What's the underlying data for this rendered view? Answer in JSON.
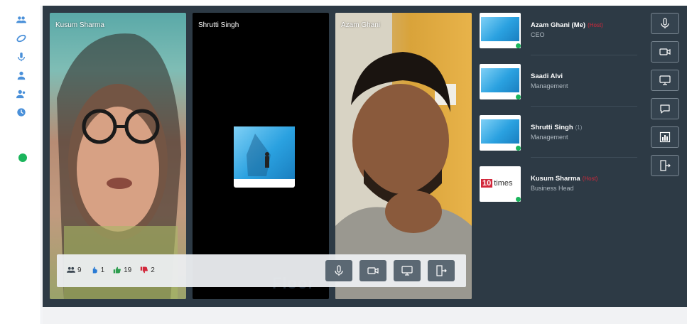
{
  "participants_tiles": [
    {
      "name": "Kusum Sharma"
    },
    {
      "name": "Shrutti Singh"
    },
    {
      "name": "Azam Ghani"
    }
  ],
  "stats": {
    "participants": "9",
    "raised_hands": "1",
    "likes": "19",
    "dislikes": "2"
  },
  "participant_list": [
    {
      "name": "Azam Ghani (Me)",
      "tag": "(Host)",
      "role": "CEO"
    },
    {
      "name": "Saadi Alvi",
      "tag": "",
      "role": "Management"
    },
    {
      "name": "Shrutti Singh",
      "tag": "(1)",
      "role": "Management"
    },
    {
      "name": "Kusum Sharma",
      "tag": "(Host)",
      "role": "Business Head"
    }
  ],
  "logo": {
    "number": "10",
    "word": "times"
  },
  "watermark": "Floor",
  "colors": {
    "accent_green": "#1bb55c",
    "host_red": "#d2283b",
    "panel": "#2d3a45"
  }
}
